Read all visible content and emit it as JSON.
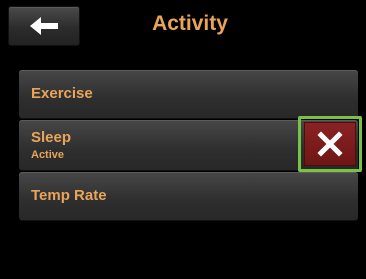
{
  "header": {
    "title": "Activity"
  },
  "menu": {
    "items": [
      {
        "label": "Exercise",
        "sublabel": ""
      },
      {
        "label": "Sleep",
        "sublabel": "Active"
      },
      {
        "label": "Temp Rate",
        "sublabel": ""
      }
    ]
  },
  "icons": {
    "back": "arrow-left-icon",
    "cancel": "close-x-icon"
  },
  "colors": {
    "text_accent": "#e8a55a",
    "cancel_bg": "#7a1a1a",
    "highlight_border": "#7ac243",
    "button_bg": "#333333",
    "screen_bg": "#000000"
  }
}
